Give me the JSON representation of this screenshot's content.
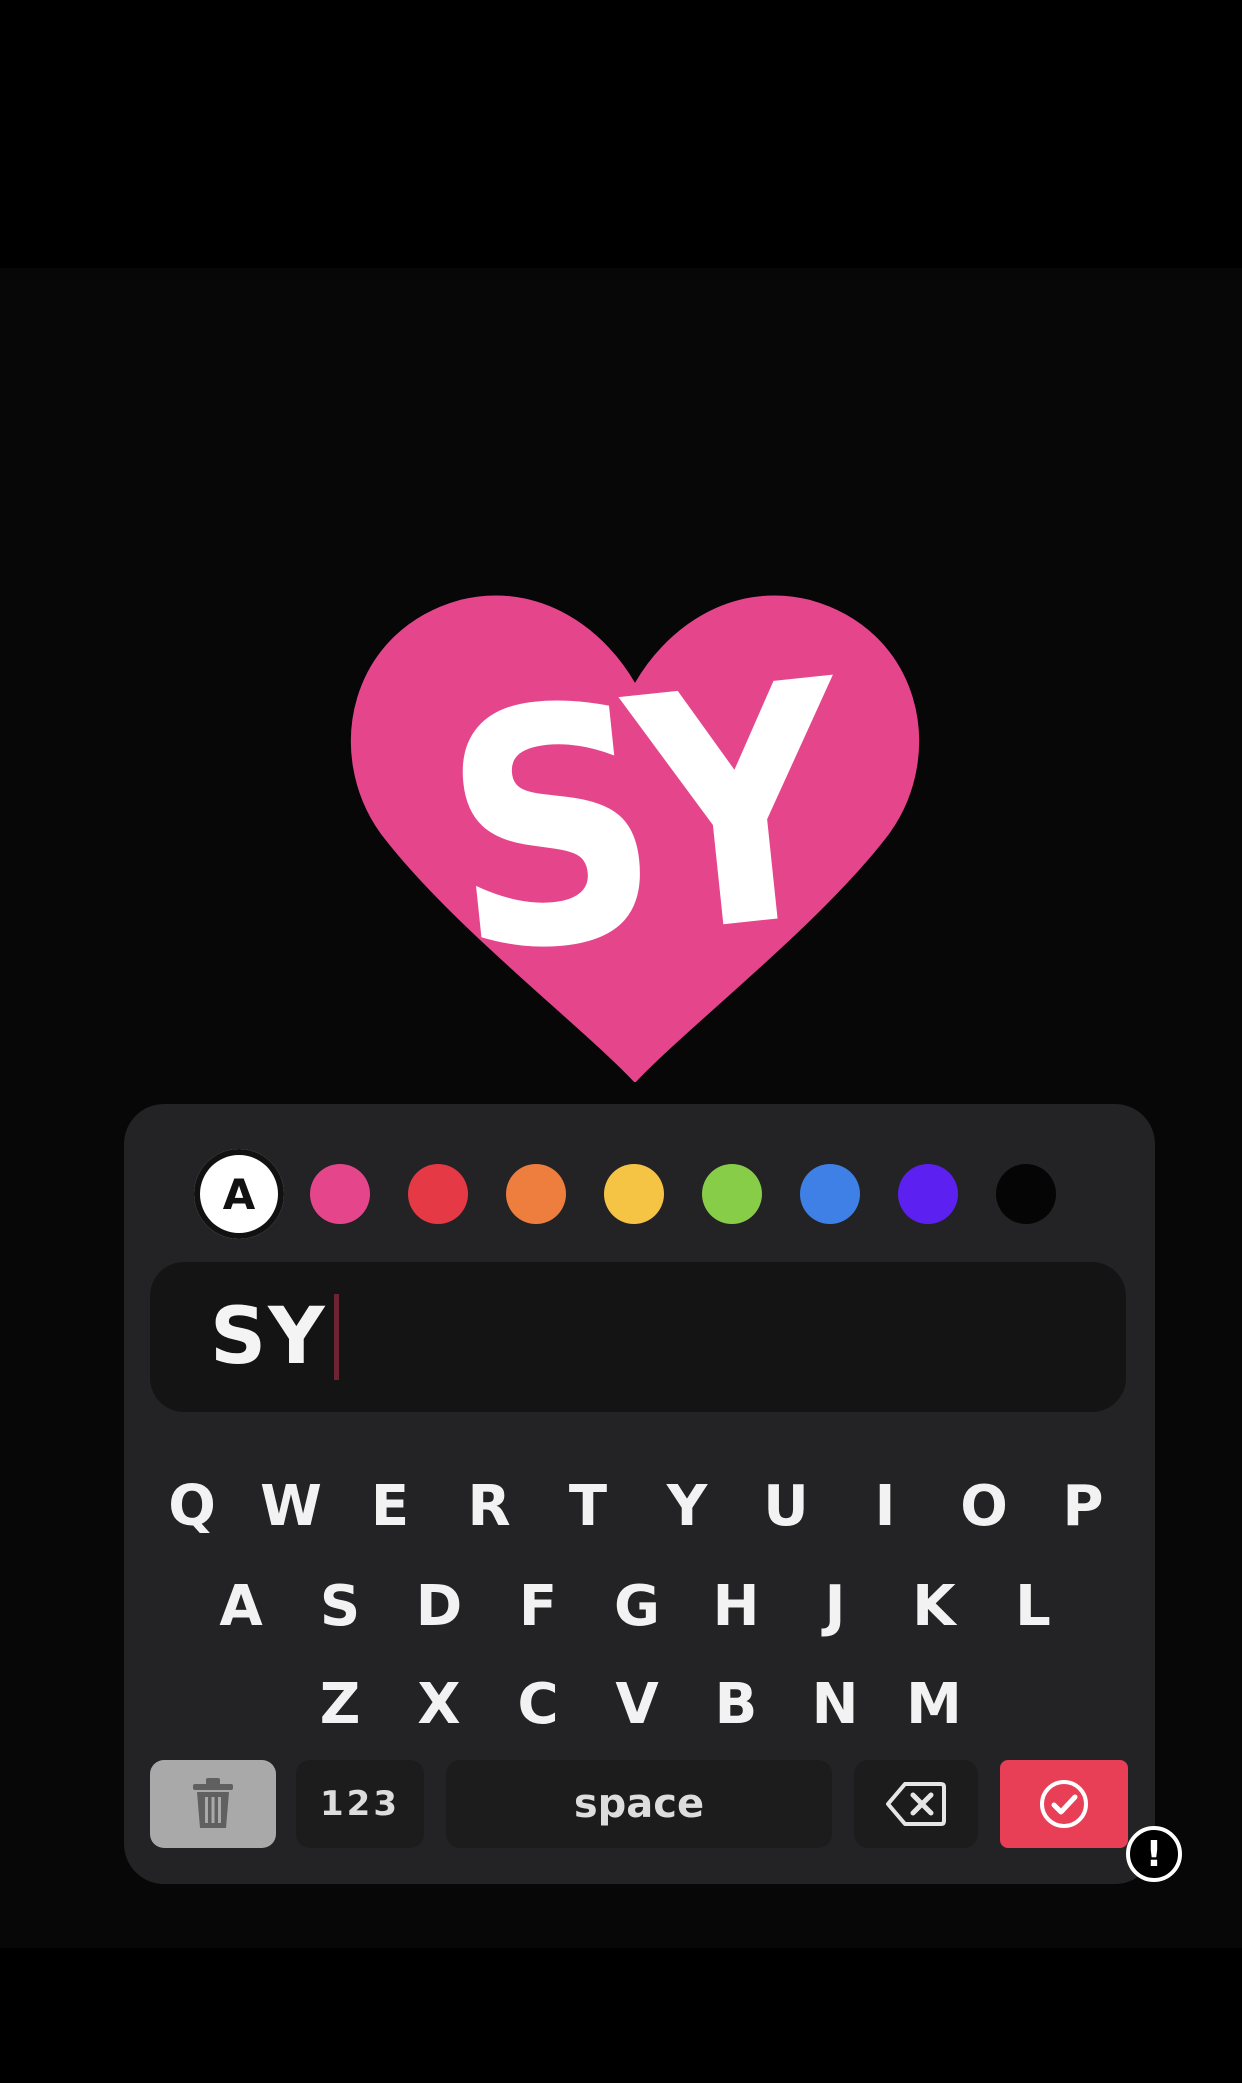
{
  "sticker": {
    "text": "SY",
    "heart_color": "#e5468b"
  },
  "color_picker": {
    "font_style_label": "A",
    "swatches": [
      {
        "name": "pink",
        "color": "#e5468b"
      },
      {
        "name": "red",
        "color": "#e53945"
      },
      {
        "name": "orange",
        "color": "#ee7e3d"
      },
      {
        "name": "yellow",
        "color": "#f6c444"
      },
      {
        "name": "green",
        "color": "#87cd47"
      },
      {
        "name": "blue",
        "color": "#3e80e6"
      },
      {
        "name": "purple",
        "color": "#5c20f0"
      },
      {
        "name": "black",
        "color": "#050505"
      }
    ]
  },
  "text_input": {
    "value": "SY"
  },
  "keyboard": {
    "row1": [
      "Q",
      "W",
      "E",
      "R",
      "T",
      "Y",
      "U",
      "I",
      "O",
      "P"
    ],
    "row2": [
      "A",
      "S",
      "D",
      "F",
      "G",
      "H",
      "J",
      "K",
      "L"
    ],
    "row3": [
      "Z",
      "X",
      "C",
      "V",
      "B",
      "N",
      "M"
    ],
    "numbers_label": "123",
    "space_label": "space"
  },
  "actions": {
    "trash_icon": "trash-icon",
    "backspace_icon": "backspace-icon",
    "done_icon": "check-circle-icon",
    "done_color": "#e83e56"
  },
  "report": {
    "label": "!"
  }
}
